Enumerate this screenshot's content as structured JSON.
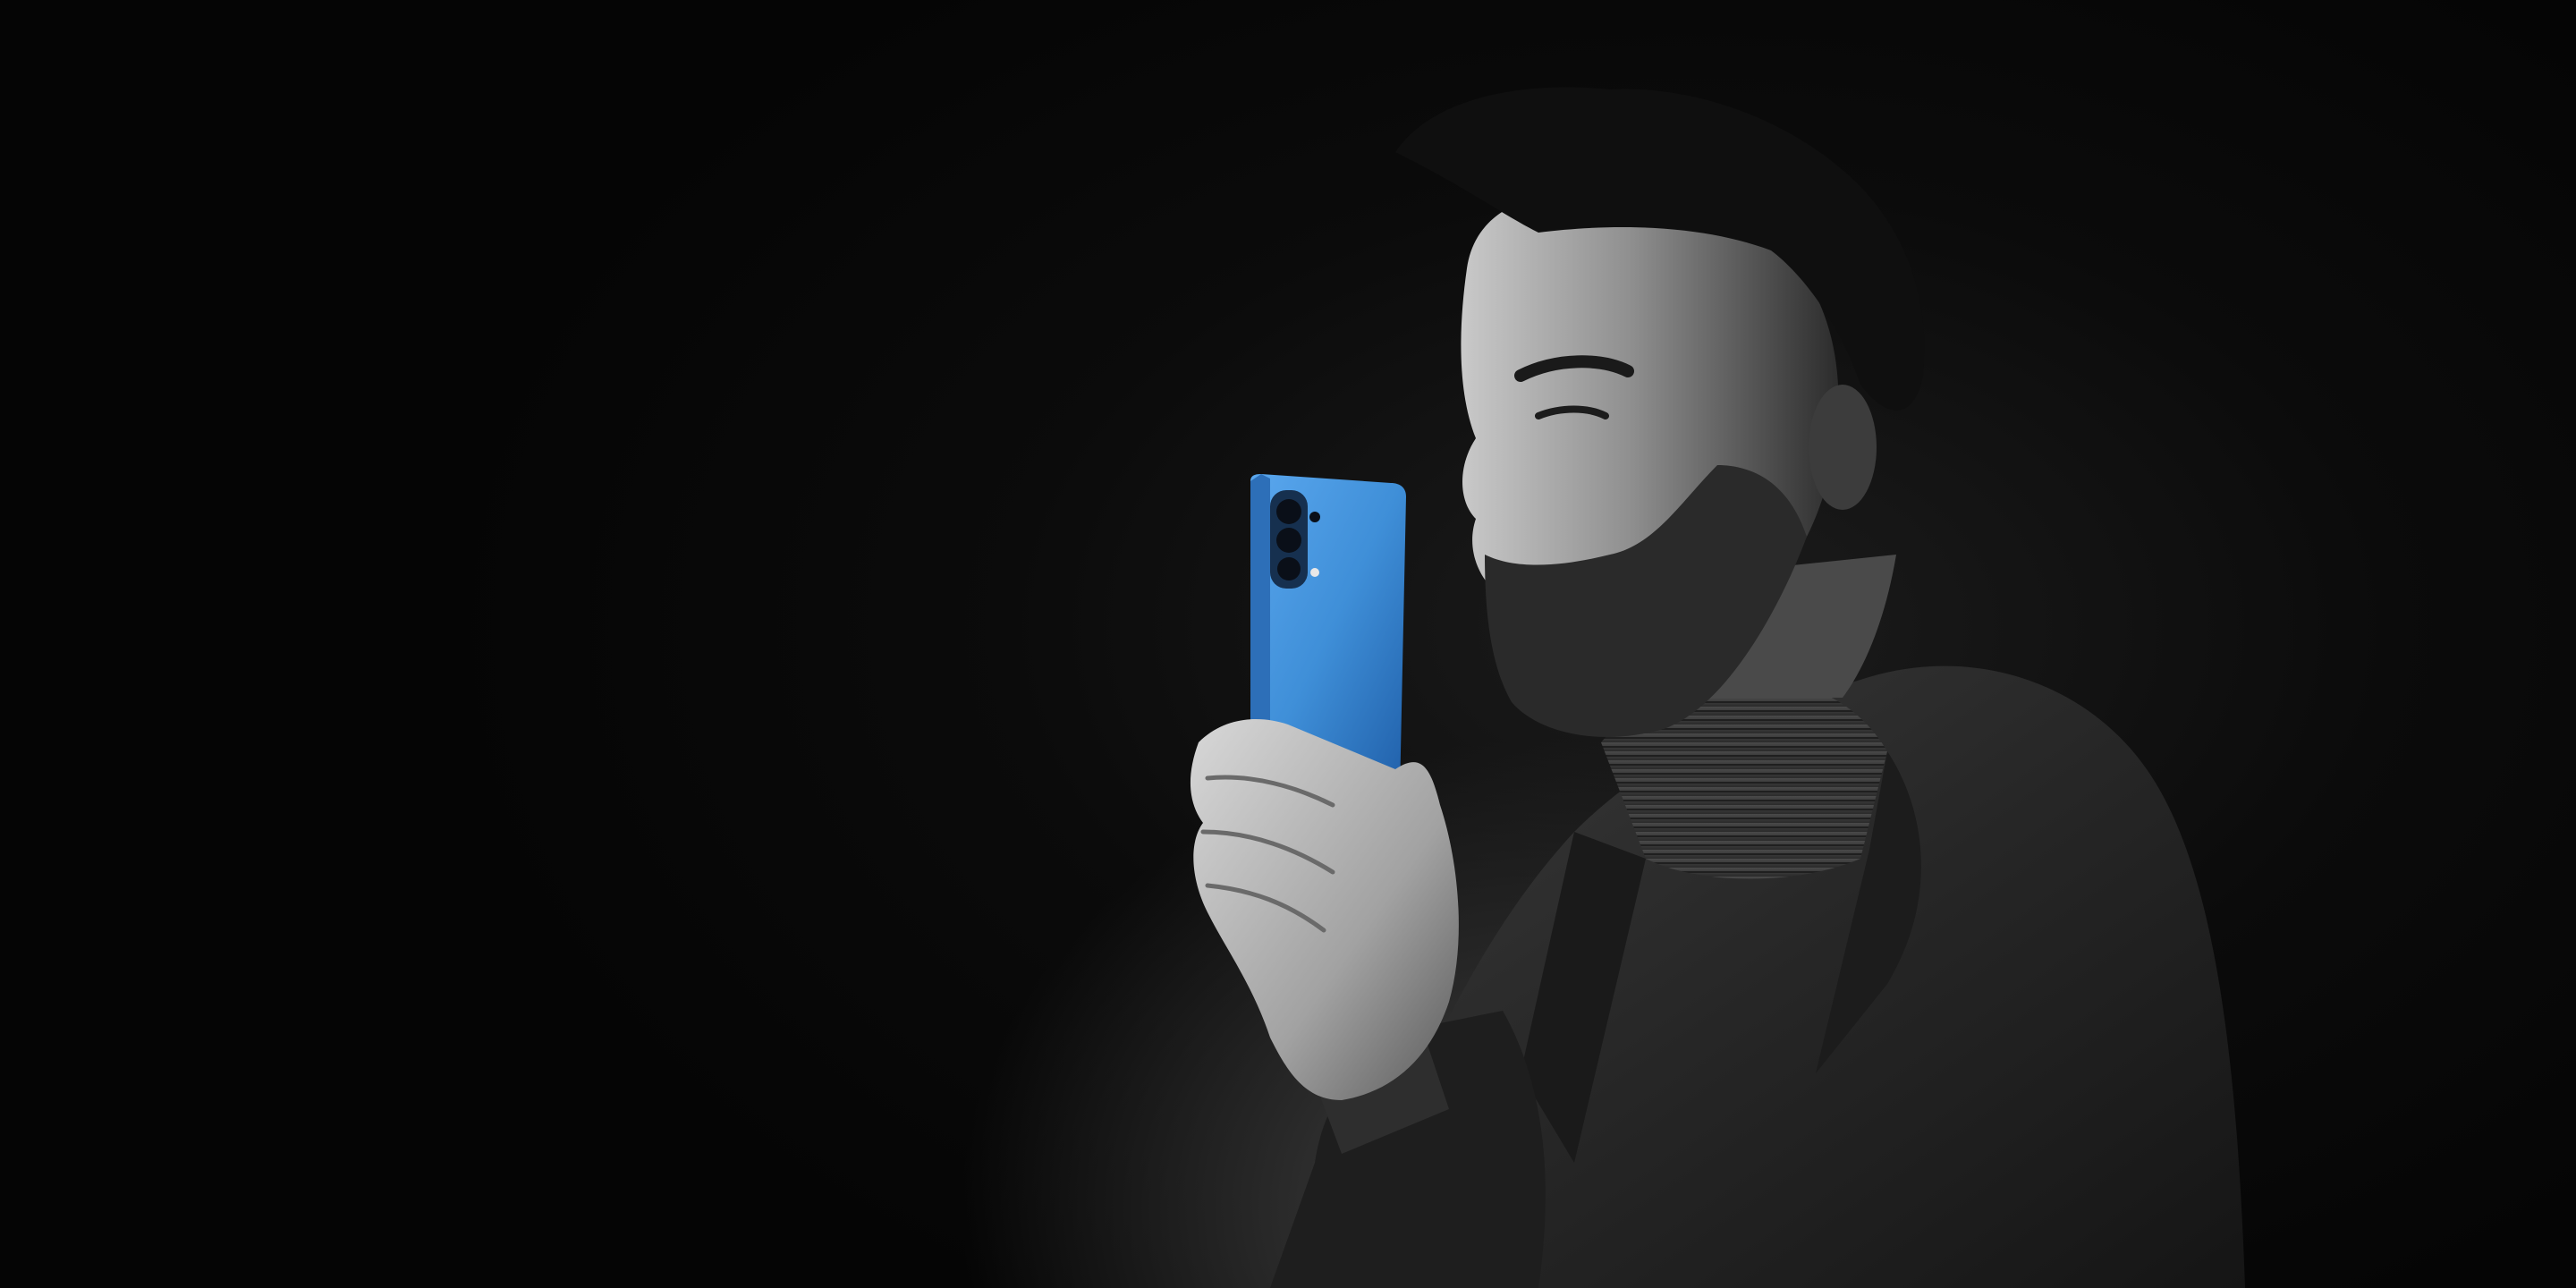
{
  "scene": {
    "description_colors": {
      "background": "#050505",
      "phone_blue": "#3f8fd8",
      "phone_blue_dark": "#1f5ea8",
      "skin_mono": "#9a9a9a",
      "jacket": "#2a2a2a"
    },
    "icons": [
      "camera-module-icon"
    ]
  }
}
